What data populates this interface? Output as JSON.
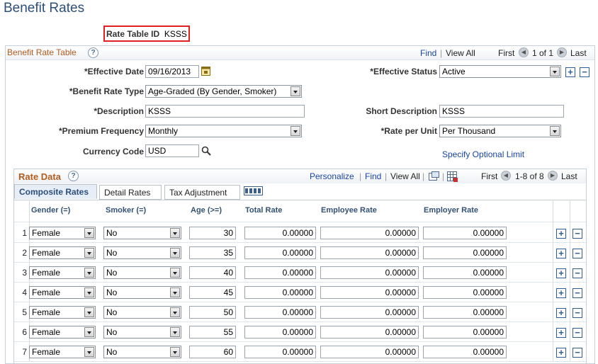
{
  "page": {
    "title": "Benefit Rates"
  },
  "rate_table_id": {
    "label": "Rate Table ID",
    "value": "KSSS"
  },
  "benefit_rate_table": {
    "title": "Benefit Rate Table",
    "help": "?",
    "find": "Find",
    "view_all": "View All",
    "first": "First",
    "counter": "1 of 1",
    "last": "Last",
    "effective_date": {
      "label": "*Effective Date",
      "value": "09/16/2013"
    },
    "effective_status": {
      "label": "*Effective Status",
      "value": "Active"
    },
    "benefit_rate_type": {
      "label": "*Benefit Rate Type",
      "value": "Age-Graded (By Gender, Smoker)"
    },
    "description": {
      "label": "*Description",
      "value": "KSSS"
    },
    "short_description": {
      "label": "Short Description",
      "value": "KSSS"
    },
    "premium_frequency": {
      "label": "*Premium Frequency",
      "value": "Monthly"
    },
    "rate_per_unit": {
      "label": "*Rate per Unit",
      "value": "Per Thousand"
    },
    "currency_code": {
      "label": "Currency Code",
      "value": "USD"
    },
    "specify_optional_limit": "Specify Optional Limit"
  },
  "rate_data": {
    "title": "Rate Data",
    "help": "?",
    "personalize": "Personalize",
    "find": "Find",
    "view_all": "View All",
    "first": "First",
    "counter": "1-8 of 8",
    "last": "Last",
    "tabs": [
      "Composite Rates",
      "Detail Rates",
      "Tax Adjustment"
    ],
    "columns": [
      "Gender (=)",
      "Smoker (=)",
      "Age (>=)",
      "Total Rate",
      "Employee Rate",
      "Employer Rate"
    ],
    "rows": [
      {
        "n": "1",
        "gender": "Female",
        "smoker": "No",
        "age": "30",
        "total": "0.00000",
        "employee": "0.00000",
        "employer": "0.00000"
      },
      {
        "n": "2",
        "gender": "Female",
        "smoker": "No",
        "age": "35",
        "total": "0.00000",
        "employee": "0.00000",
        "employer": "0.00000"
      },
      {
        "n": "3",
        "gender": "Female",
        "smoker": "No",
        "age": "40",
        "total": "0.00000",
        "employee": "0.00000",
        "employer": "0.00000"
      },
      {
        "n": "4",
        "gender": "Female",
        "smoker": "No",
        "age": "45",
        "total": "0.00000",
        "employee": "0.00000",
        "employer": "0.00000"
      },
      {
        "n": "5",
        "gender": "Female",
        "smoker": "No",
        "age": "50",
        "total": "0.00000",
        "employee": "0.00000",
        "employer": "0.00000"
      },
      {
        "n": "6",
        "gender": "Female",
        "smoker": "No",
        "age": "55",
        "total": "0.00000",
        "employee": "0.00000",
        "employer": "0.00000"
      },
      {
        "n": "7",
        "gender": "Female",
        "smoker": "No",
        "age": "60",
        "total": "0.00000",
        "employee": "0.00000",
        "employer": "0.00000"
      }
    ]
  },
  "colors": {
    "title": "#2d4f77",
    "section_title": "#b25c1e",
    "link": "#1846a4",
    "highlight_border": "#e02020"
  }
}
